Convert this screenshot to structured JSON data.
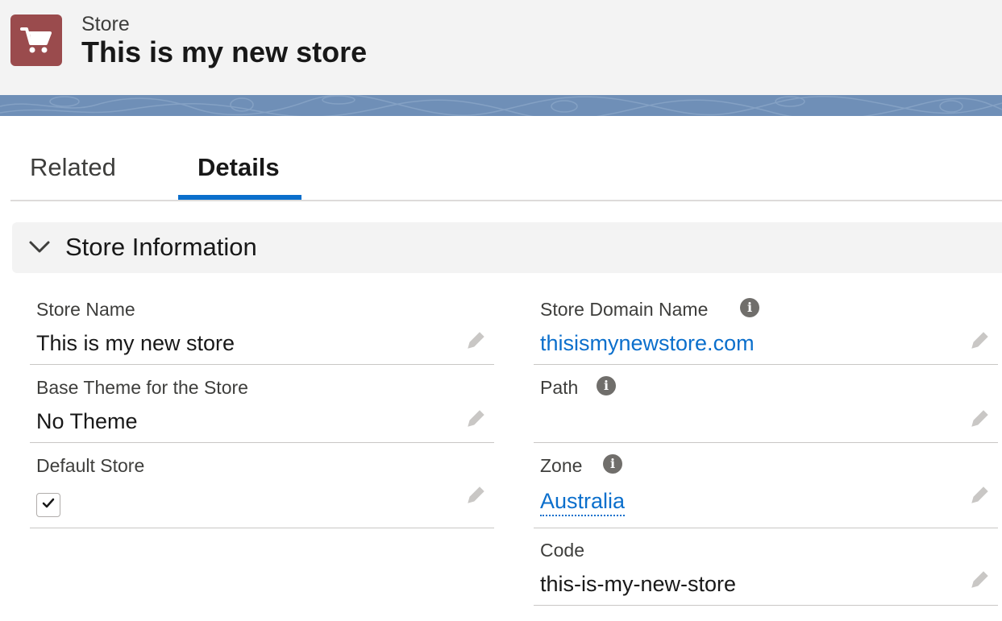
{
  "header": {
    "object_label": "Store",
    "record_title": "This is my new store",
    "icon": "shopping-cart-icon",
    "icon_color": "#9a4b4d"
  },
  "tabs": [
    {
      "label": "Related",
      "active": false
    },
    {
      "label": "Details",
      "active": true
    }
  ],
  "accent_color": "#0b6fcc",
  "section": {
    "title": "Store Information",
    "expanded": true
  },
  "fields": {
    "store_name": {
      "label": "Store Name",
      "value": "This is my new store"
    },
    "base_theme": {
      "label": "Base Theme for the Store",
      "value": "No Theme"
    },
    "default_store": {
      "label": "Default Store",
      "checked": true
    },
    "store_domain": {
      "label": "Store Domain Name",
      "value": "thisismynewstore.com",
      "info": "i"
    },
    "path": {
      "label": "Path",
      "value": "",
      "info": "i"
    },
    "zone": {
      "label": "Zone",
      "value": "Australia",
      "info": "i"
    },
    "code": {
      "label": "Code",
      "value": "this-is-my-new-store"
    }
  }
}
